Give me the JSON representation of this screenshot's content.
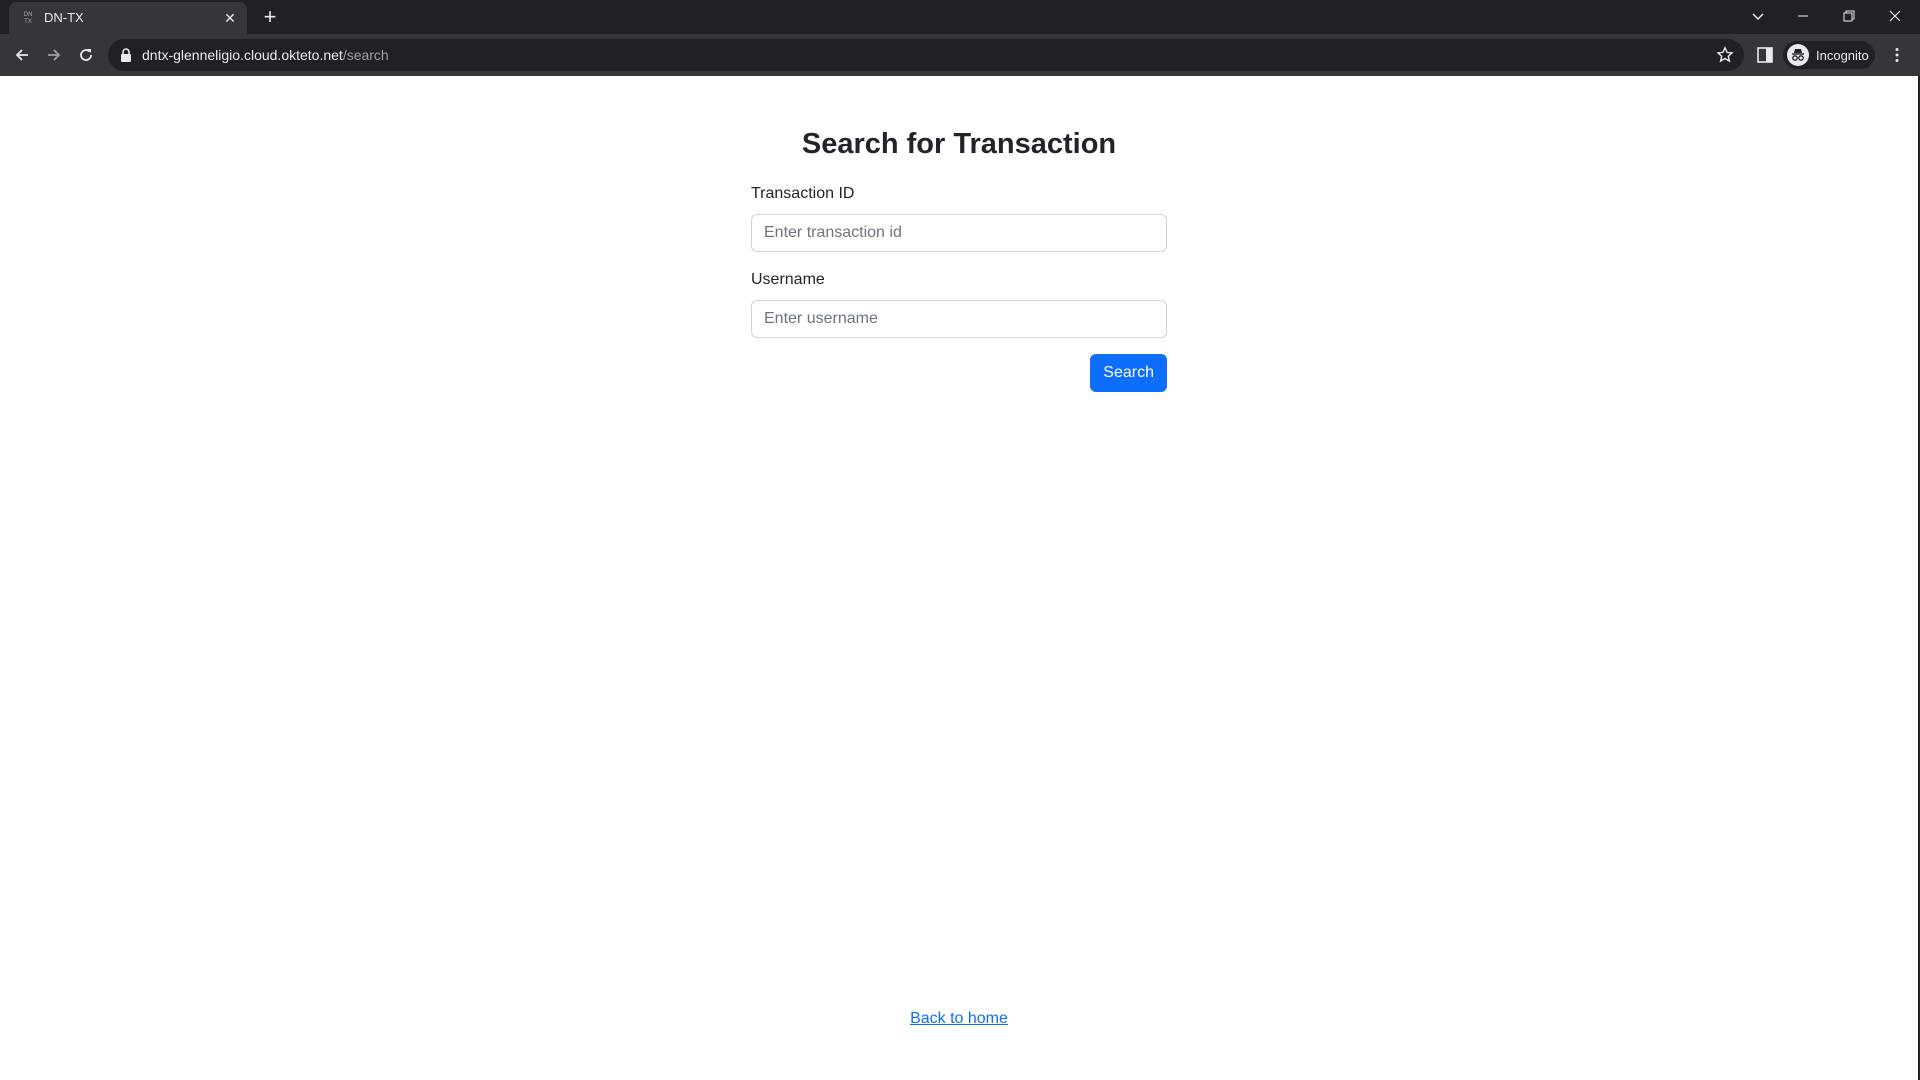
{
  "browser": {
    "tab_title": "DN-TX",
    "favicon_text": "DN TX",
    "url_host": "dntx-glenneligio.cloud.okteto.net",
    "url_path": "/search",
    "profile_label": "Incognito"
  },
  "page": {
    "title": "Search for Transaction",
    "transaction_id_label": "Transaction ID",
    "transaction_id_placeholder": "Enter transaction id",
    "username_label": "Username",
    "username_placeholder": "Enter username",
    "search_button": "Search",
    "back_link": "Back to home"
  },
  "colors": {
    "primary": "#0d6efd",
    "chrome_dark": "#202124",
    "toolbar": "#35363a"
  }
}
